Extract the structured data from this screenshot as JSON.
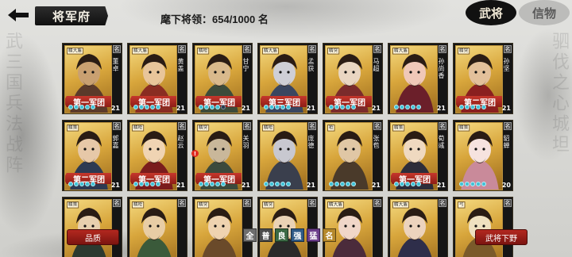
{
  "header": {
    "title": "将军府",
    "capacity": "麾下将领：654/1000 名",
    "tabs": [
      {
        "label": "武将",
        "active": true
      },
      {
        "label": "信物",
        "active": false
      }
    ]
  },
  "cards": [
    {
      "rank": "精大盾",
      "name": "董卓",
      "corps": "第一军团",
      "level": "21",
      "ming": "名",
      "dots_on": 5
    },
    {
      "rank": "精大盾",
      "name": "黄盖",
      "corps": "第一军团",
      "level": "21",
      "ming": "名",
      "dots_on": 5
    },
    {
      "rank": "精枪",
      "name": "甘宁",
      "corps": "第一军团",
      "level": "21",
      "ming": "名",
      "dots_on": 4
    },
    {
      "rank": "精大盾",
      "name": "孟获",
      "corps": "第三军团",
      "level": "21",
      "ming": "名",
      "dots_on": 5
    },
    {
      "rank": "精突",
      "name": "马超",
      "corps": "第一军团",
      "level": "21",
      "ming": "名",
      "dots_on": 5
    },
    {
      "rank": "精大盾",
      "name": "孙尚香",
      "corps": "",
      "level": "21",
      "ming": "名",
      "dots_on": 5
    },
    {
      "rank": "精突",
      "name": "孙坚",
      "corps": "第二军团",
      "level": "21",
      "ming": "名",
      "dots_on": 5
    },
    {
      "rank": "精策",
      "name": "郭嘉",
      "corps": "第二军团",
      "level": "21",
      "ming": "名",
      "dots_on": 5
    },
    {
      "rank": "精枪",
      "name": "赵云",
      "corps": "第一军团",
      "level": "21",
      "ming": "名",
      "dots_on": 5
    },
    {
      "rank": "精突",
      "name": "关羽",
      "corps": "第一军团",
      "level": "21",
      "ming": "名",
      "dots_on": 5
    },
    {
      "rank": "精枪",
      "name": "庞德",
      "corps": "",
      "level": "21",
      "ming": "名",
      "dots_on": 5
    },
    {
      "rank": "枪",
      "name": "张苞",
      "corps": "",
      "level": "21",
      "ming": "名",
      "dots_on": 5
    },
    {
      "rank": "精策",
      "name": "荀彧",
      "corps": "第一军团",
      "level": "21",
      "ming": "名",
      "dots_on": 5
    },
    {
      "rank": "精策",
      "name": "貂蝉",
      "corps": "",
      "level": "20",
      "ming": "名",
      "dots_on": 5
    },
    {
      "rank": "精策",
      "name": "",
      "corps": "",
      "level": "",
      "ming": "名",
      "dots_on": 0
    },
    {
      "rank": "精枪",
      "name": "",
      "corps": "",
      "level": "",
      "ming": "名",
      "dots_on": 0
    },
    {
      "rank": "精突",
      "name": "",
      "corps": "",
      "level": "",
      "ming": "名",
      "dots_on": 0
    },
    {
      "rank": "精突",
      "name": "",
      "corps": "",
      "level": "",
      "ming": "名",
      "dots_on": 0
    },
    {
      "rank": "精大盾",
      "name": "",
      "corps": "",
      "level": "",
      "ming": "名",
      "dots_on": 0
    },
    {
      "rank": "精大盾",
      "name": "",
      "corps": "",
      "level": "",
      "ming": "名",
      "dots_on": 0
    },
    {
      "rank": "弓",
      "name": "",
      "corps": "",
      "level": "",
      "ming": "名",
      "dots_on": 0
    }
  ],
  "notification_badge": "!",
  "footer": {
    "quality_button": "品质",
    "dismiss_button": "武将下野",
    "filters": [
      {
        "label": "全",
        "color": "#6e6e6e"
      },
      {
        "label": "普",
        "color": "#4d4d4d"
      },
      {
        "label": "良",
        "color": "#3b6a45"
      },
      {
        "label": "强",
        "color": "#2f5a86"
      },
      {
        "label": "猛",
        "color": "#6b3d8a"
      },
      {
        "label": "名",
        "color": "#b5892c"
      }
    ]
  },
  "colors": {
    "accent_red": "#b3281f",
    "card_gold": "#d8a63c",
    "tab_active": "#111111"
  }
}
